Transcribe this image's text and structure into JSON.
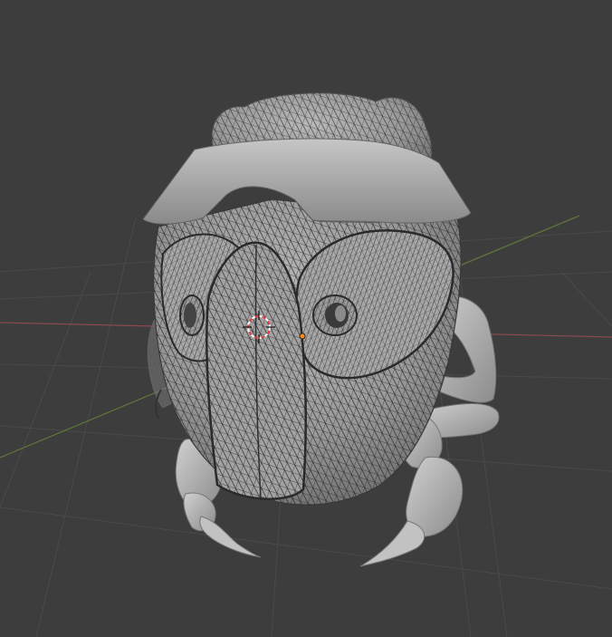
{
  "app": {
    "name": "3D viewport",
    "view_mode": "wireframe-overlay",
    "background_color": "#3d3d3d"
  },
  "grid": {
    "line_color": "#4a4a4a",
    "x_axis_color": "#8a4a50",
    "y_axis_color": "#5f7a3a"
  },
  "model": {
    "description_icon": "beetle-sculpt-icon",
    "surface_color": "#9a9a9a",
    "highlight_color": "#c4c4c4",
    "shadow_color": "#6e6e6e",
    "wire_color": "#2c2c2c"
  },
  "cursor": {
    "icon": "3d-cursor-icon",
    "ring_color_a": "#e04040",
    "ring_color_b": "#ffffff"
  },
  "origin": {
    "icon": "object-origin-icon",
    "color": "#ff8c1a"
  }
}
